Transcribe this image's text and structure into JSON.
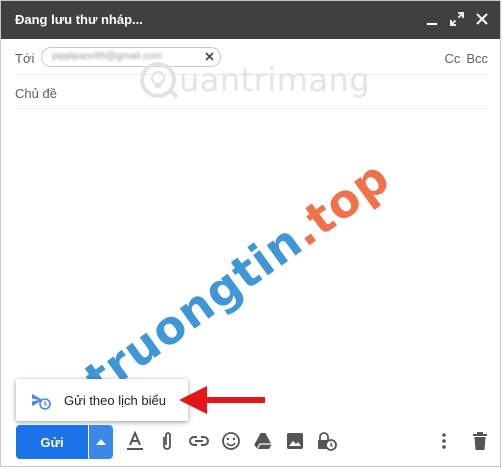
{
  "window": {
    "title": "Đang lưu thư nháp..."
  },
  "to": {
    "label": "Tới",
    "recipient": "pippipaov95@gmail.com",
    "cc": "Cc",
    "bcc": "Bcc"
  },
  "subject": {
    "label": "Chủ đề"
  },
  "watermark": {
    "top": "uantrimang",
    "diag_part1": "truongtin",
    "diag_part2": ".top"
  },
  "popup": {
    "label": "Gửi theo lịch biểu"
  },
  "toolbar": {
    "send_label": "Gửi"
  },
  "colors": {
    "titlebar": "#404040",
    "send": "#1a73e8",
    "arrow": "#e3161b"
  }
}
